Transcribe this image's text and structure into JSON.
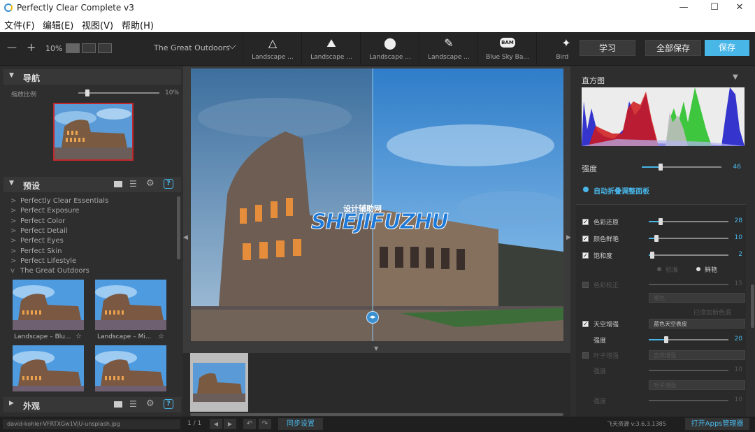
{
  "window": {
    "title": "Perfectly Clear Complete v3",
    "min": "—",
    "max": "☐",
    "close": "✕"
  },
  "menu": [
    "文件(F)",
    "编辑(E)",
    "视图(V)",
    "帮助(H)"
  ],
  "toolbar": {
    "zoom_out": "—",
    "zoom_in": "+",
    "zoom": "10%",
    "preset_group": "The Great Outdoors",
    "dropdown_arrow": "⌵",
    "presets": [
      {
        "label": "Landscape ...",
        "icon": "△"
      },
      {
        "label": "Landscape ...",
        "icon": "⛰"
      },
      {
        "label": "Landscape ...",
        "icon": "⬤"
      },
      {
        "label": "Landscape ...",
        "icon": "✎"
      },
      {
        "label": "Blue Sky Ba...",
        "icon": "BAM"
      },
      {
        "label": "Bird ...",
        "icon": "✦"
      }
    ],
    "learn": "学习",
    "save_all": "全部保存",
    "save": "保存"
  },
  "navigator": {
    "title": "导航",
    "zoom_label": "缩放比例",
    "zoom_value": "10%",
    "zoom_fraction": 0.11
  },
  "presets_panel": {
    "title": "预设",
    "groups": [
      {
        "label": "Perfectly Clear Essentials",
        "chev": ">"
      },
      {
        "label": "Perfect Exposure",
        "chev": ">"
      },
      {
        "label": "Perfect Color",
        "chev": ">"
      },
      {
        "label": "Perfect Detail",
        "chev": ">"
      },
      {
        "label": "Perfect Eyes",
        "chev": ">"
      },
      {
        "label": "Perfect Skin",
        "chev": ">"
      },
      {
        "label": "Perfect Lifestyle",
        "chev": ">"
      },
      {
        "label": "The Great Outdoors",
        "chev": "v"
      }
    ],
    "thumbs": [
      {
        "label": "Landscape – Blu..."
      },
      {
        "label": "Landscape – Mi..."
      },
      {
        "label": ""
      },
      {
        "label": ""
      }
    ],
    "star": "☆"
  },
  "appearance": {
    "title": "外观"
  },
  "right": {
    "histogram_title": "直方图",
    "strength_label": "强度",
    "strength_value": "46",
    "strength_fraction": 0.24,
    "auto_panel": "自动折叠调整面板",
    "rows": [
      {
        "label": "色彩还原",
        "value": "28",
        "checked": true,
        "fraction": 0.15
      },
      {
        "label": "颜色鲜艳",
        "value": "10",
        "checked": true,
        "fraction": 0.1
      },
      {
        "label": "饱和度",
        "value": "2",
        "checked": true,
        "fraction": 0.04
      }
    ],
    "radio_a": "标准",
    "radio_b": "鲜艳",
    "dim_row": {
      "label": "色彩校正",
      "value": "15"
    },
    "dim_ddl": "暖色",
    "dim_caption": "已添加新色调",
    "sky_label": "天空增强",
    "sky_ddl": "蓝色天空表皮",
    "sky_checked": true,
    "sky_strength_label": "强度",
    "sky_strength_value": "20",
    "sky_fraction": 0.22,
    "foliage_label": "叶子增强",
    "foliage_ddl": "自然增强",
    "foliage_strength_label": "强度",
    "foliage_strength_value": "10",
    "extra_ddl": "叶子增强",
    "extra_strength_label": "强度",
    "extra_strength_value": "10"
  },
  "watermark": {
    "cn": "设计辅助网",
    "en": "SHEJIFUZHU"
  },
  "status": {
    "filename": "david-kohler-VFRTXGw1VjU-unsplash.jpg",
    "page": "1 / 1",
    "sync": "同步设置",
    "version": "飞天资源 v:3.6.3.1385",
    "open_apps": "打开Apps管理器"
  },
  "colors": {
    "accent": "#49b6e8"
  }
}
